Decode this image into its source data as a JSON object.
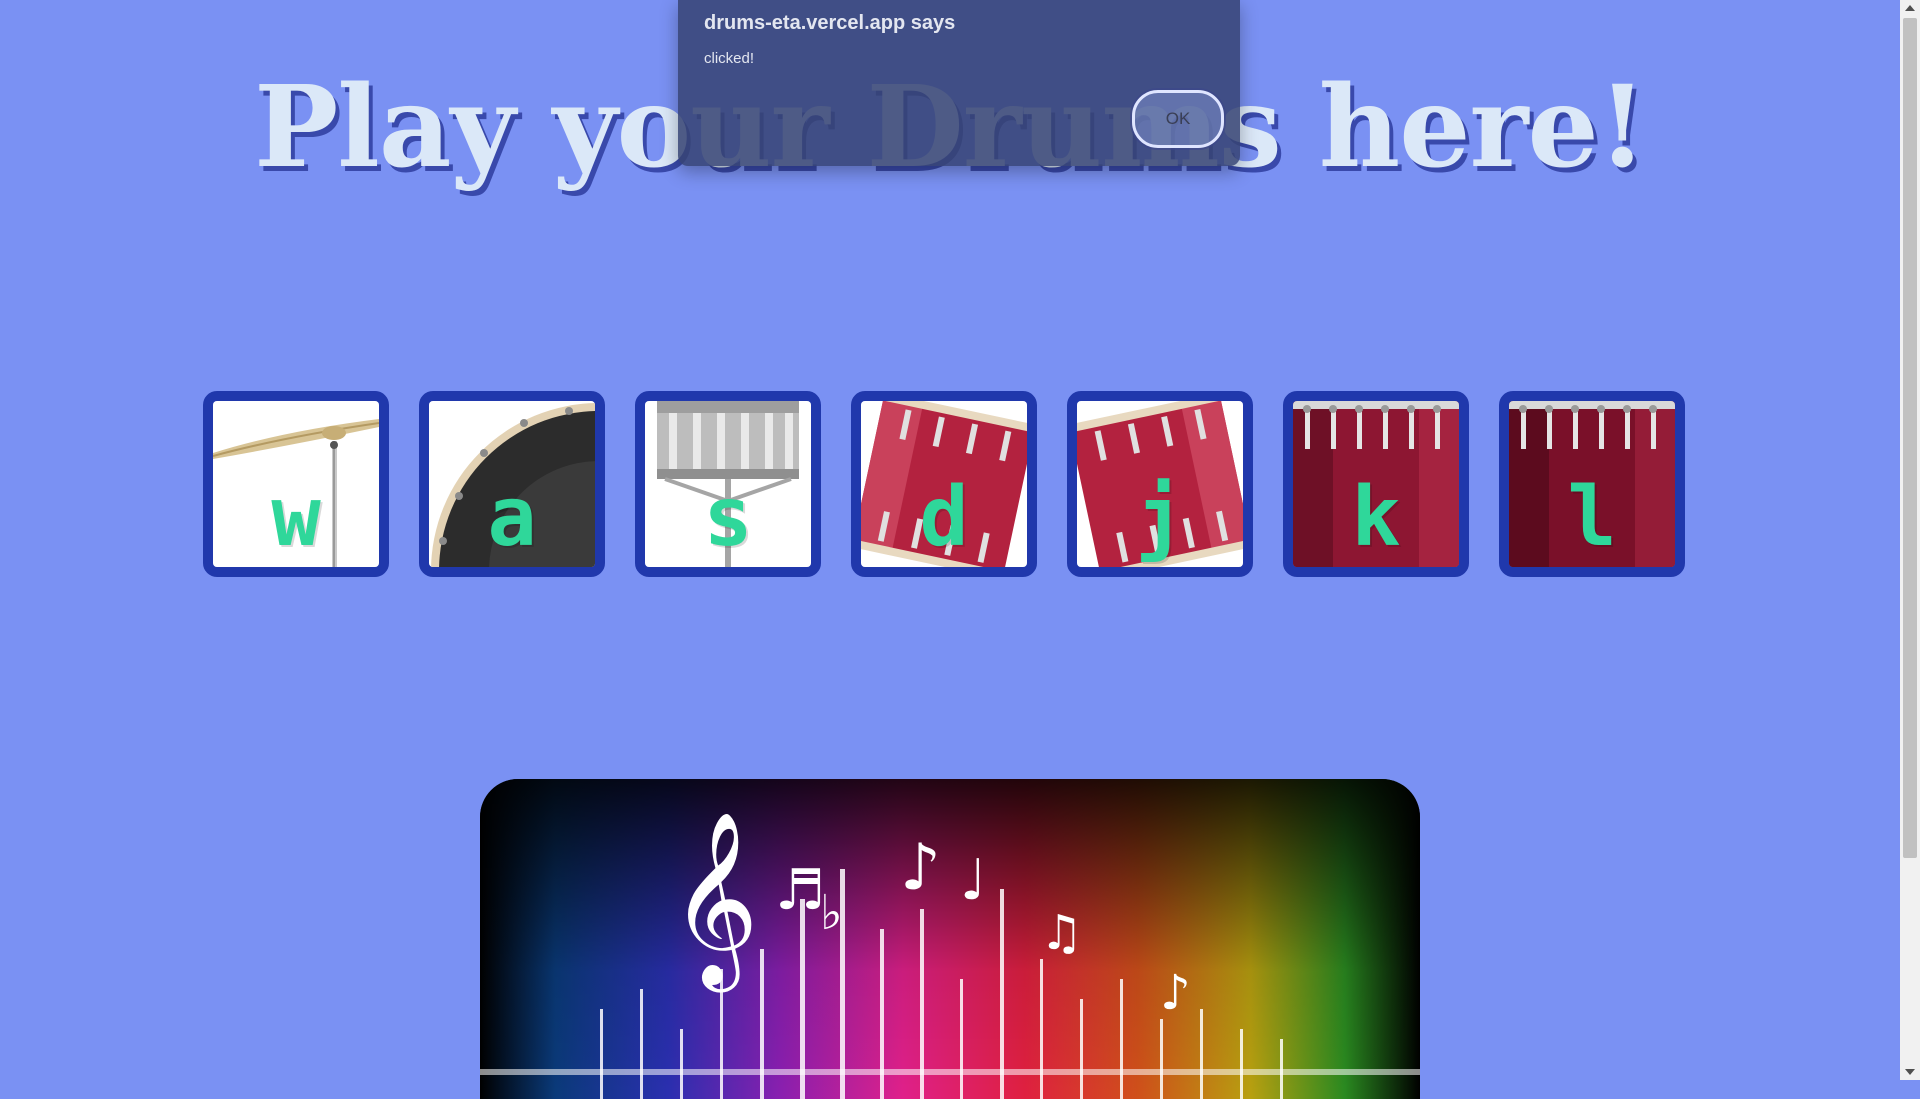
{
  "page": {
    "title": "Play your Drums here!"
  },
  "drums": [
    {
      "key": "w",
      "instrument": "crash-cymbal"
    },
    {
      "key": "a",
      "instrument": "kick-drum"
    },
    {
      "key": "s",
      "instrument": "snare-drum"
    },
    {
      "key": "d",
      "instrument": "tom-1"
    },
    {
      "key": "j",
      "instrument": "tom-2"
    },
    {
      "key": "k",
      "instrument": "tom-3"
    },
    {
      "key": "l",
      "instrument": "tom-4"
    }
  ],
  "alert": {
    "origin": "drums-eta.vercel.app says",
    "message": "clicked!",
    "ok_label": "OK"
  },
  "colors": {
    "background": "#7a91f3",
    "tile_border": "#2038ac",
    "key_letter": "#2fd79a",
    "title": "#dbe8f8",
    "title_shadow": "#3949ab",
    "drum_red": "#b3223f"
  },
  "banner": {
    "image": "music-notes-rainbow-spectrum-banner"
  }
}
